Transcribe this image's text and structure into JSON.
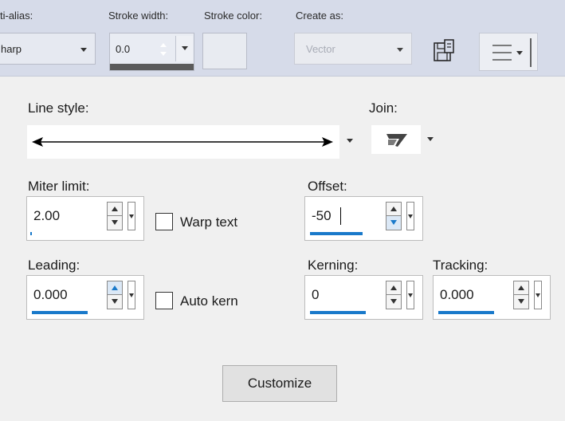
{
  "toolbar": {
    "anti_alias_label": "ti-alias:",
    "anti_alias_value": "harp",
    "stroke_width_label": "Stroke width:",
    "stroke_width_value": "0.0",
    "stroke_color_label": "Stroke color:",
    "create_as_label": "Create as:",
    "create_as_value": "Vector"
  },
  "panel": {
    "line_style_label": "Line style:",
    "join_label": "Join:",
    "miter_limit_label": "Miter limit:",
    "miter_limit_value": "2.00",
    "warp_text_label": "Warp text",
    "warp_text_checked": false,
    "offset_label": "Offset:",
    "offset_value": "-50",
    "leading_label": "Leading:",
    "leading_value": "0.000",
    "auto_kern_label": "Auto kern",
    "auto_kern_checked": false,
    "kerning_label": "Kerning:",
    "kerning_value": "0",
    "tracking_label": "Tracking:",
    "tracking_value": "0.000",
    "customize_label": "Customize"
  },
  "icons": {
    "save_preset": "save-preset-icon",
    "menu": "menu-icon",
    "join_style": "join-miter-icon",
    "line_style": "double-arrow-line-icon"
  },
  "colors": {
    "toolbar_bg": "#d6dbe9",
    "panel_bg": "#f0f0f0",
    "focus_accent": "#1979ca"
  }
}
